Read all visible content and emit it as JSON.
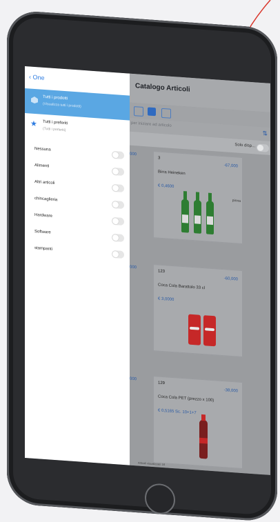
{
  "sidebar": {
    "back_label": "One",
    "selected": {
      "title": "Tutti i prodotti",
      "subtitle": "(Visualizza tutti i prodotti)"
    },
    "favorites": {
      "title": "Tutti i preferiti",
      "subtitle": "(Tutti i preferiti)"
    },
    "categories": [
      "Nessuna",
      "Alimenti",
      "Altri articoli",
      "chincaglieria",
      "Hardware",
      "Software",
      "stampanti"
    ]
  },
  "catalog": {
    "title": "Catalogo Articoli",
    "search_placeholder": "per iniziare ad articolo",
    "filter_label": "Solo disp...",
    "left_values": [
      "000",
      "000",
      "000"
    ],
    "cards": [
      {
        "code": "3",
        "discount": "-67,000",
        "name": "Birra Heineken",
        "price": "€ 0,4600",
        "unit": "pinna"
      },
      {
        "code": "123",
        "discount": "-60,000",
        "name": "Coca Cola Barattolo 33 cl",
        "price": "€ 3,0000"
      },
      {
        "code": "129",
        "discount": "-38,000",
        "name": "Coca Cola PET (prezzo x 100)",
        "price": "€ 0,5165",
        "extra": "Sc. 10+1+7"
      }
    ],
    "footer_note": "Articoli visualizzati: 16"
  },
  "colors": {
    "accent": "#2f7de1",
    "selected_row": "#5aa7e3",
    "device": "#2b2c2f",
    "red_curve": "#d9362b"
  }
}
